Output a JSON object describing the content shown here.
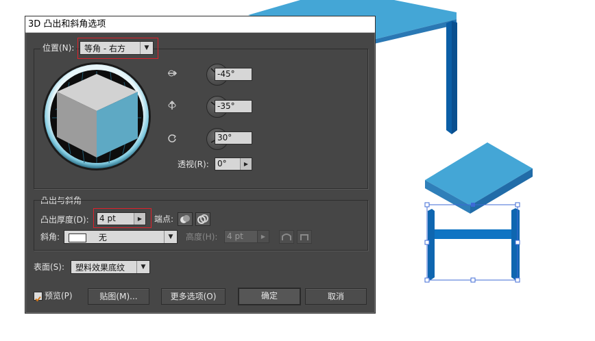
{
  "dialog": {
    "title": "3D 凸出和斜角选项",
    "position": {
      "group_label": "位置(N):",
      "preset_value": "等角 - 右方",
      "rotation_x": "-45°",
      "rotation_y": "-35°",
      "rotation_z": "30°",
      "perspective_label": "透视(R):",
      "perspective_value": "0°"
    },
    "extrude": {
      "group_title": "凸出与斜角",
      "depth_label": "凸出厚度(D):",
      "depth_value": "4 pt",
      "cap_label": "端点:",
      "bevel_label": "斜角:",
      "bevel_value": "无",
      "height_label": "高度(H):",
      "height_value": "4 pt"
    },
    "surface": {
      "label": "表面(S):",
      "value": "塑料效果底纹"
    },
    "footer": {
      "preview_label": "预览(P)",
      "preview_checked": true,
      "map_button": "贴图(M)...",
      "more_button": "更多选项(O)",
      "ok_button": "确定",
      "cancel_button": "取消"
    }
  },
  "colors": {
    "dialog_bg": "#464646",
    "highlight": "#e0202a",
    "table_top": "#44a6d6",
    "table_side": "#2a78b4",
    "leg": "#0a5ea6",
    "selection": "#3d6ad6",
    "cube_front": "#5ea9c4",
    "cube_left": "#9c9c9c",
    "cube_top": "#d2d2d2"
  }
}
